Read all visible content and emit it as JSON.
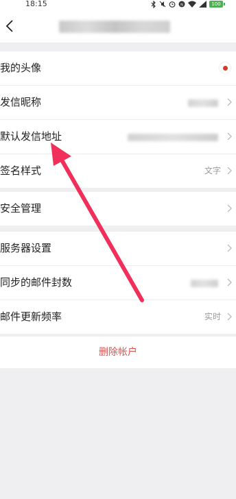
{
  "status_bar": {
    "time": "18:15",
    "battery": "100"
  },
  "nav": {
    "back_icon": "chevron-left-icon",
    "title": ""
  },
  "groups": [
    {
      "rows": [
        {
          "label": "我的头像",
          "value": "",
          "kind": "avatar"
        },
        {
          "label": "发信昵称",
          "value": "",
          "kind": "blurred"
        },
        {
          "label": "默认发信地址",
          "value": "",
          "kind": "blurred"
        },
        {
          "label": "签名样式",
          "value": "文字",
          "kind": "text"
        }
      ]
    },
    {
      "rows": [
        {
          "label": "安全管理",
          "value": "",
          "kind": "chevron"
        }
      ]
    },
    {
      "rows": [
        {
          "label": "服务器设置",
          "value": "",
          "kind": "chevron"
        },
        {
          "label": "同步的邮件封数",
          "value": "",
          "kind": "blurred"
        },
        {
          "label": "邮件更新频率",
          "value": "实时",
          "kind": "text"
        }
      ]
    }
  ],
  "delete_account": "删除帐户",
  "annotation": {
    "arrow_color": "#f0305a"
  },
  "colors": {
    "background": "#efeff2",
    "danger": "#d9534f",
    "avatar_accent": "#d43a2a"
  }
}
